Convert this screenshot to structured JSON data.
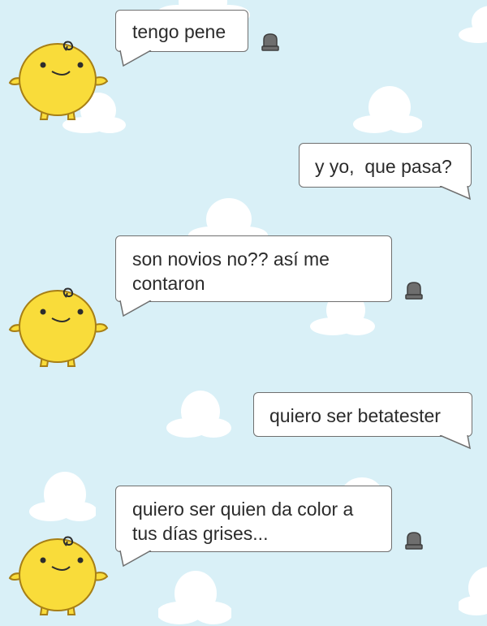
{
  "conversation": {
    "messages": [
      {
        "sender": "bot",
        "text": "tengo pene"
      },
      {
        "sender": "user",
        "text": "y yo,  que pasa?"
      },
      {
        "sender": "bot",
        "text": "son novios no?? así me contaron"
      },
      {
        "sender": "user",
        "text": "quiero ser betatester"
      },
      {
        "sender": "bot",
        "text": "quiero ser quien da color a tus días grises..."
      }
    ]
  },
  "icons": {
    "avatar": "simsimi-avatar-icon",
    "report": "siren-report-icon",
    "background": "cloud-icon"
  },
  "colors": {
    "background": "#d9f0f7",
    "avatar_yellow": "#f9dc3a",
    "bubble_border": "#6f6f6f"
  }
}
